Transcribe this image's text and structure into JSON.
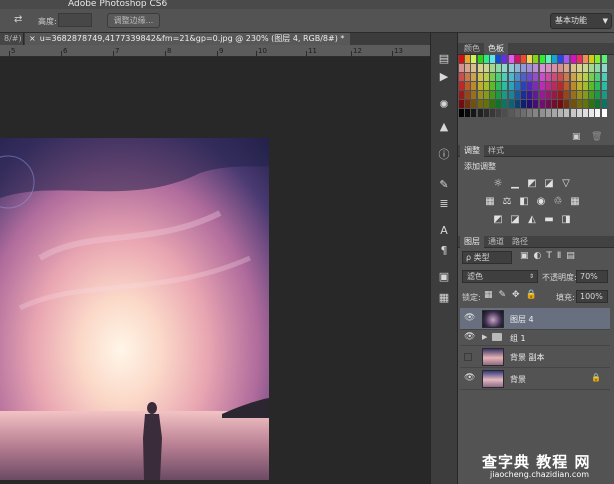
{
  "app": {
    "title": "Adobe Photoshop CS6"
  },
  "options_bar": {
    "height_label": "高度:",
    "refine_edge_button": "调整边缘...",
    "workspace": "基本功能"
  },
  "tabs": [
    {
      "label": "8/#) *"
    },
    {
      "label": "u=3682878749,4177339842&fm=21&gp=0.jpg @ 230% (图层 4, RGB/8#) *",
      "close": "×"
    }
  ],
  "ruler": {
    "labels": [
      "5",
      "6",
      "7",
      "8",
      "9",
      "10",
      "11",
      "12",
      "13"
    ]
  },
  "swatches_panel": {
    "tabs": [
      "颜色",
      "色板"
    ],
    "active_tab": "色板"
  },
  "adjustments_panel": {
    "tabs": [
      "调整",
      "样式"
    ],
    "active_tab": "调整",
    "heading": "添加调整"
  },
  "layers_panel": {
    "tabs": [
      "图层",
      "通道",
      "路径"
    ],
    "active_tab": "图层",
    "filter_label": "ρ 类型",
    "blend_mode": "滤色",
    "opacity_label": "不透明度:",
    "opacity_value": "70%",
    "lock_label": "锁定:",
    "fill_label": "填充:",
    "fill_value": "100%",
    "layers": [
      {
        "name": "图层 4",
        "visible": true,
        "selected": true
      },
      {
        "name": "组 1",
        "visible": true,
        "selected": false
      },
      {
        "name": "背景 副本",
        "visible": false,
        "selected": false
      },
      {
        "name": "背景",
        "visible": true,
        "selected": false,
        "locked": true
      }
    ]
  },
  "watermark": {
    "line1": "查字典 教程 网",
    "line2": "jiaocheng.chazidian.com"
  },
  "colors": {
    "selection": "#687080",
    "panel": "#535353",
    "panel_header": "#424242",
    "canvas_bg": "#282828"
  }
}
